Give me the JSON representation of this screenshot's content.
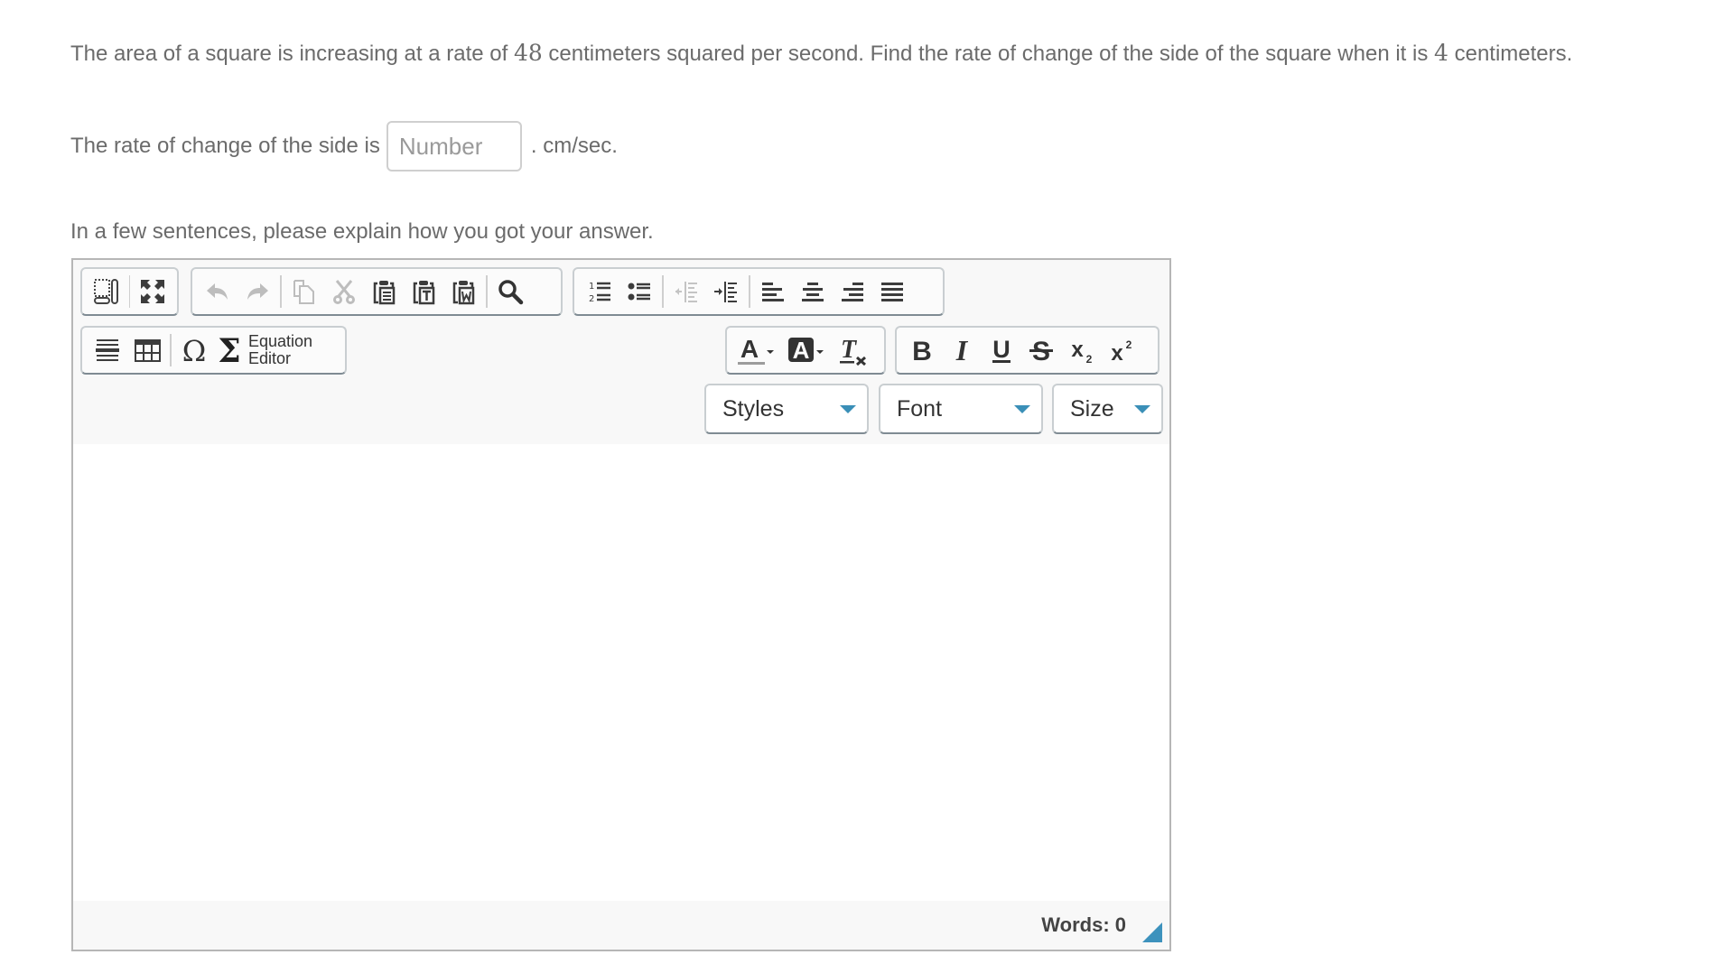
{
  "question": {
    "part1": "The area of a square is increasing at a rate of ",
    "rate_value": "48",
    "part2": " centimeters squared per second. Find the rate of change of the side of the square when it is ",
    "side_value": "4",
    "part3": " centimeters."
  },
  "answer": {
    "prefix": "The rate of change of the side is",
    "input_value": "",
    "input_placeholder": "Number",
    "suffix": ". cm/sec."
  },
  "explain_prompt": "In a few sentences, please explain how you got your answer.",
  "editor": {
    "toolbar_row1": {
      "group1": [
        "show-blocks",
        "maximize"
      ],
      "group2": [
        "undo",
        "redo",
        "copy",
        "cut",
        "paste",
        "paste-as-text",
        "paste-from-word",
        "find"
      ],
      "group3": [
        "numbered-list",
        "bulleted-list",
        "decrease-indent",
        "increase-indent",
        "align-left",
        "align-center",
        "align-right",
        "justify"
      ]
    },
    "toolbar_row2": {
      "group1": [
        "horizontal-line",
        "table",
        "special-character",
        "equation-editor"
      ],
      "equation_label_line1": "Equation",
      "equation_label_line2": "Editor",
      "color_group": [
        "text-color",
        "background-color",
        "remove-format"
      ],
      "format_group": [
        "bold",
        "italic",
        "underline",
        "strikethrough",
        "subscript",
        "superscript"
      ]
    },
    "combos": {
      "styles": "Styles",
      "font": "Font",
      "size": "Size"
    },
    "content": "",
    "word_count_label": "Words: 0",
    "accent_color": "#3d92bd"
  }
}
